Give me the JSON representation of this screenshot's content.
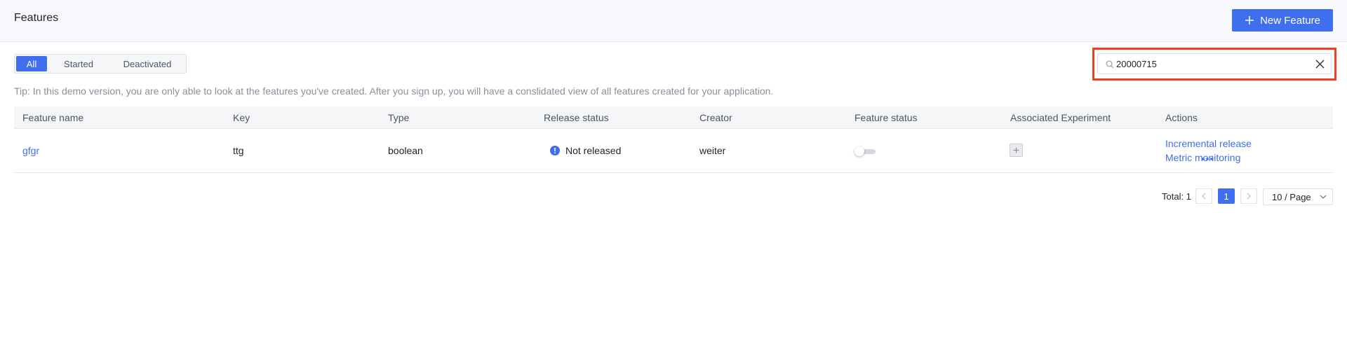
{
  "header": {
    "title": "Features",
    "new_button_label": "New Feature"
  },
  "filters": {
    "tabs": [
      {
        "label": "All",
        "active": true
      },
      {
        "label": "Started",
        "active": false
      },
      {
        "label": "Deactivated",
        "active": false
      }
    ]
  },
  "search": {
    "value": "20000715",
    "placeholder": ""
  },
  "tip": "Tip: In this demo version, you are only able to look at the features you've created. After you sign up, you will have a conslidated view of all features created for your application.",
  "table": {
    "columns": [
      "Feature name",
      "Key",
      "Type",
      "Release status",
      "Creator",
      "Feature status",
      "Associated Experiment",
      "Actions"
    ],
    "rows": [
      {
        "name": "gfgr",
        "key": "ttg",
        "type": "boolean",
        "release_status": "Not released",
        "creator": "weiter",
        "feature_status_enabled": false,
        "actions": [
          "Incremental release",
          "Metric monitoring"
        ]
      }
    ]
  },
  "pagination": {
    "total": "Total: 1",
    "current_page": "1",
    "page_size": "10 / Page"
  },
  "colors": {
    "primary": "#3f6fee",
    "highlight": "#e8421e",
    "header_bg": "#f8f9fc"
  }
}
